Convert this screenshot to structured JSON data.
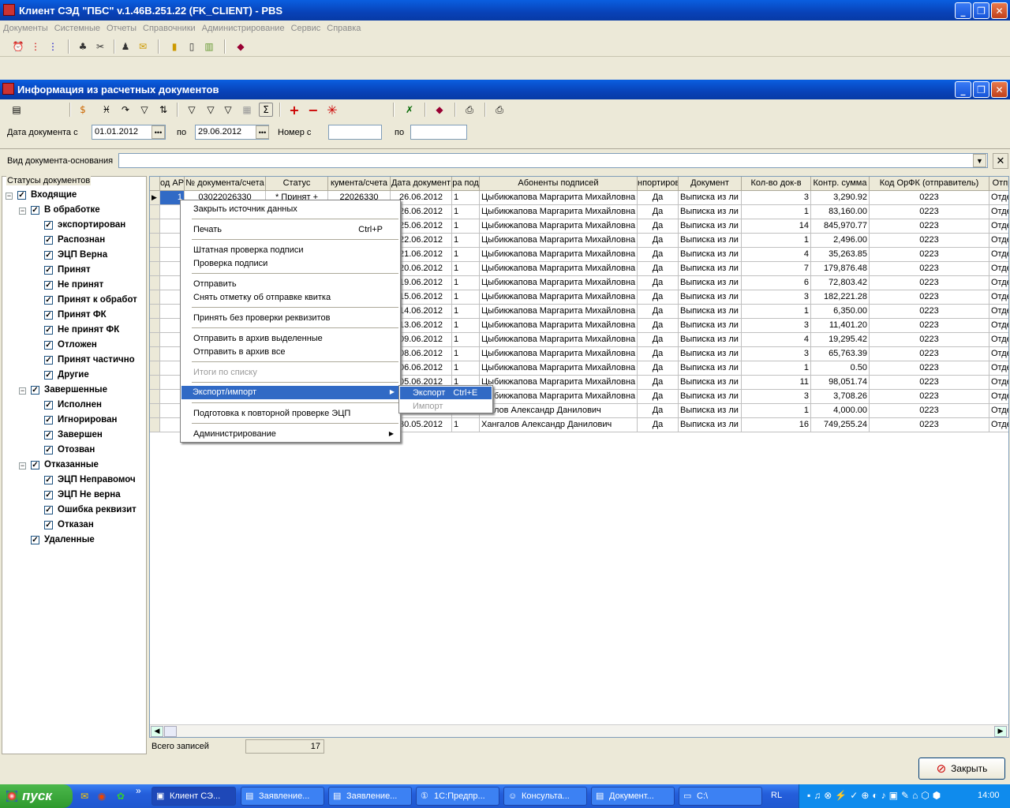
{
  "app_title": "Клиент СЭД \"ПБС\" v.1.46B.251.22 (FK_CLIENT) - PBS",
  "menu": [
    "Документы",
    "Системные",
    "Отчеты",
    "Справочники",
    "Администрирование",
    "Сервис",
    "Справка"
  ],
  "window_title": "Информация из расчетных документов",
  "filter": {
    "date_from_label": "Дата документа с",
    "date_from": "01.01.2012",
    "to_label": "по",
    "date_to": "29.06.2012",
    "number_label": "Номер с",
    "number_to_label": "по",
    "basis_label": "Вид документа-основания"
  },
  "tree": {
    "caption": "Статусы документов",
    "incoming": "Входящие",
    "processing": "В обработке",
    "processing_items": [
      "экспортирован",
      "Распознан",
      "ЭЦП Верна",
      "Принят",
      "Не принят",
      "Принят к обработ",
      "Принят ФК",
      "Не принят ФК",
      "Отложен",
      "Принят частично",
      "Другие"
    ],
    "completed": "Завершенные",
    "completed_items": [
      "Исполнен",
      "Игнорирован",
      "Завершен",
      "Отозван"
    ],
    "rejected": "Отказанные",
    "rejected_items": [
      "ЭЦП Неправомоч",
      "ЭЦП Не верна",
      "Ошибка реквизит",
      "Отказан"
    ],
    "deleted": "Удаленные"
  },
  "grid": {
    "headers": [
      "од АР",
      "№ документа/счета",
      "Статус",
      "кумента/счета",
      "Дата документ",
      "ра под",
      "Абоненты подписей",
      "нпортиров",
      "Документ",
      "Кол-во док-в",
      "Контр. сумма",
      "Код ОрФК (отправитель)",
      "Отпра"
    ],
    "first_row": {
      "num": "03022026330",
      "status": "* Принят +",
      "acct": "22026330"
    },
    "rows": [
      {
        "date": "26.06.2012",
        "n": "1",
        "abon": "Цыбикжапова Маргарита Михайловна",
        "imp": "Да",
        "doc": "Выписка из ли",
        "cnt": "3",
        "sum": "3,290.92",
        "code": "0223",
        "send": "Отде"
      },
      {
        "date": "26.06.2012",
        "n": "1",
        "abon": "Цыбикжапова Маргарита Михайловна",
        "imp": "Да",
        "doc": "Выписка из ли",
        "cnt": "1",
        "sum": "83,160.00",
        "code": "0223",
        "send": "Отде"
      },
      {
        "date": "25.06.2012",
        "n": "1",
        "abon": "Цыбикжапова Маргарита Михайловна",
        "imp": "Да",
        "doc": "Выписка из ли",
        "cnt": "14",
        "sum": "845,970.77",
        "code": "0223",
        "send": "Отде"
      },
      {
        "date": "22.06.2012",
        "n": "1",
        "abon": "Цыбикжапова Маргарита Михайловна",
        "imp": "Да",
        "doc": "Выписка из ли",
        "cnt": "1",
        "sum": "2,496.00",
        "code": "0223",
        "send": "Отде"
      },
      {
        "date": "21.06.2012",
        "n": "1",
        "abon": "Цыбикжапова Маргарита Михайловна",
        "imp": "Да",
        "doc": "Выписка из ли",
        "cnt": "4",
        "sum": "35,263.85",
        "code": "0223",
        "send": "Отде"
      },
      {
        "date": "20.06.2012",
        "n": "1",
        "abon": "Цыбикжапова Маргарита Михайловна",
        "imp": "Да",
        "doc": "Выписка из ли",
        "cnt": "7",
        "sum": "179,876.48",
        "code": "0223",
        "send": "Отде"
      },
      {
        "date": "19.06.2012",
        "n": "1",
        "abon": "Цыбикжапова Маргарита Михайловна",
        "imp": "Да",
        "doc": "Выписка из ли",
        "cnt": "6",
        "sum": "72,803.42",
        "code": "0223",
        "send": "Отде"
      },
      {
        "date": "15.06.2012",
        "n": "1",
        "abon": "Цыбикжапова Маргарита Михайловна",
        "imp": "Да",
        "doc": "Выписка из ли",
        "cnt": "3",
        "sum": "182,221.28",
        "code": "0223",
        "send": "Отде"
      },
      {
        "date": "14.06.2012",
        "n": "1",
        "abon": "Цыбикжапова Маргарита Михайловна",
        "imp": "Да",
        "doc": "Выписка из ли",
        "cnt": "1",
        "sum": "6,350.00",
        "code": "0223",
        "send": "Отде"
      },
      {
        "date": "13.06.2012",
        "n": "1",
        "abon": "Цыбикжапова Маргарита Михайловна",
        "imp": "Да",
        "doc": "Выписка из ли",
        "cnt": "3",
        "sum": "11,401.20",
        "code": "0223",
        "send": "Отде"
      },
      {
        "date": "09.06.2012",
        "n": "1",
        "abon": "Цыбикжапова Маргарита Михайловна",
        "imp": "Да",
        "doc": "Выписка из ли",
        "cnt": "4",
        "sum": "19,295.42",
        "code": "0223",
        "send": "Отде"
      },
      {
        "date": "08.06.2012",
        "n": "1",
        "abon": "Цыбикжапова Маргарита Михайловна",
        "imp": "Да",
        "doc": "Выписка из ли",
        "cnt": "3",
        "sum": "65,763.39",
        "code": "0223",
        "send": "Отде"
      },
      {
        "date": "06.06.2012",
        "n": "1",
        "abon": "Цыбикжапова Маргарита Михайловна",
        "imp": "Да",
        "doc": "Выписка из ли",
        "cnt": "1",
        "sum": "0.50",
        "code": "0223",
        "send": "Отде"
      },
      {
        "date": "05.06.2012",
        "n": "1",
        "abon": "Цыбикжапова Маргарита Михайловна",
        "imp": "Да",
        "doc": "Выписка из ли",
        "cnt": "11",
        "sum": "98,051.74",
        "code": "0223",
        "send": "Отде"
      },
      {
        "date": "",
        "n": "",
        "abon": "Цыбикжапова Маргарита Михайловна",
        "imp": "Да",
        "doc": "Выписка из ли",
        "cnt": "3",
        "sum": "3,708.26",
        "code": "0223",
        "send": "Отде"
      },
      {
        "date": "",
        "n": "",
        "abon": "нгалов Александр Данилович",
        "imp": "Да",
        "doc": "Выписка из ли",
        "cnt": "1",
        "sum": "4,000.00",
        "code": "0223",
        "send": "Отде"
      },
      {
        "date": "30.05.2012",
        "n": "1",
        "abon": "Хангалов Александр Данилович",
        "imp": "Да",
        "doc": "Выписка из ли",
        "cnt": "16",
        "sum": "749,255.24",
        "code": "0223",
        "send": "Отде"
      }
    ]
  },
  "status": {
    "total_label": "Всего записей",
    "total": "17"
  },
  "close_label": "Закрыть",
  "context_menu": {
    "close_source": "Закрыть источник данных",
    "print": "Печать",
    "print_sc": "Ctrl+P",
    "check_std": "Штатная проверка подписи",
    "check_sig": "Проверка подписи",
    "send": "Отправить",
    "unmark": "Снять отметку об отправке квитка",
    "accept_nocheck": "Принять без проверки реквизитов",
    "archive_sel": "Отправить в архив выделенные",
    "archive_all": "Отправить в архив все",
    "totals": "Итоги по списку",
    "export_import": "Экспорт/импорт",
    "prepare": "Подготовка к повторной проверке ЭЦП",
    "admin": "Администрирование"
  },
  "submenu": {
    "export": "Экспорт",
    "export_sc": "Ctrl+E",
    "import": "Импорт"
  },
  "taskbar": {
    "start": "пуск",
    "tasks": [
      "Клиент СЭ...",
      "Заявление...",
      "Заявление...",
      "1С:Предпр...",
      "Консульта...",
      "Документ...",
      "C:\\"
    ],
    "lang": "RL",
    "clock": "14:00"
  }
}
